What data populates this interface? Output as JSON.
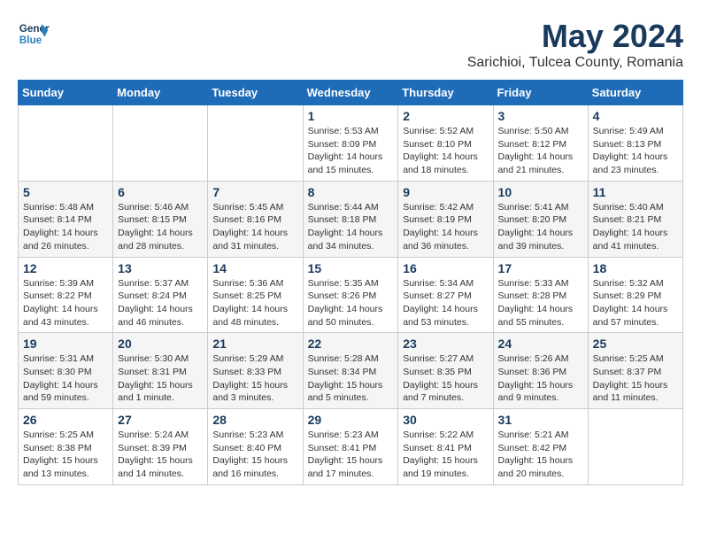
{
  "logo": {
    "line1": "General",
    "line2": "Blue"
  },
  "title": "May 2024",
  "subtitle": "Sarichioi, Tulcea County, Romania",
  "days_of_week": [
    "Sunday",
    "Monday",
    "Tuesday",
    "Wednesday",
    "Thursday",
    "Friday",
    "Saturday"
  ],
  "weeks": [
    [
      {
        "day": "",
        "sunrise": "",
        "sunset": "",
        "daylight": ""
      },
      {
        "day": "",
        "sunrise": "",
        "sunset": "",
        "daylight": ""
      },
      {
        "day": "",
        "sunrise": "",
        "sunset": "",
        "daylight": ""
      },
      {
        "day": "1",
        "sunrise": "Sunrise: 5:53 AM",
        "sunset": "Sunset: 8:09 PM",
        "daylight": "Daylight: 14 hours and 15 minutes."
      },
      {
        "day": "2",
        "sunrise": "Sunrise: 5:52 AM",
        "sunset": "Sunset: 8:10 PM",
        "daylight": "Daylight: 14 hours and 18 minutes."
      },
      {
        "day": "3",
        "sunrise": "Sunrise: 5:50 AM",
        "sunset": "Sunset: 8:12 PM",
        "daylight": "Daylight: 14 hours and 21 minutes."
      },
      {
        "day": "4",
        "sunrise": "Sunrise: 5:49 AM",
        "sunset": "Sunset: 8:13 PM",
        "daylight": "Daylight: 14 hours and 23 minutes."
      }
    ],
    [
      {
        "day": "5",
        "sunrise": "Sunrise: 5:48 AM",
        "sunset": "Sunset: 8:14 PM",
        "daylight": "Daylight: 14 hours and 26 minutes."
      },
      {
        "day": "6",
        "sunrise": "Sunrise: 5:46 AM",
        "sunset": "Sunset: 8:15 PM",
        "daylight": "Daylight: 14 hours and 28 minutes."
      },
      {
        "day": "7",
        "sunrise": "Sunrise: 5:45 AM",
        "sunset": "Sunset: 8:16 PM",
        "daylight": "Daylight: 14 hours and 31 minutes."
      },
      {
        "day": "8",
        "sunrise": "Sunrise: 5:44 AM",
        "sunset": "Sunset: 8:18 PM",
        "daylight": "Daylight: 14 hours and 34 minutes."
      },
      {
        "day": "9",
        "sunrise": "Sunrise: 5:42 AM",
        "sunset": "Sunset: 8:19 PM",
        "daylight": "Daylight: 14 hours and 36 minutes."
      },
      {
        "day": "10",
        "sunrise": "Sunrise: 5:41 AM",
        "sunset": "Sunset: 8:20 PM",
        "daylight": "Daylight: 14 hours and 39 minutes."
      },
      {
        "day": "11",
        "sunrise": "Sunrise: 5:40 AM",
        "sunset": "Sunset: 8:21 PM",
        "daylight": "Daylight: 14 hours and 41 minutes."
      }
    ],
    [
      {
        "day": "12",
        "sunrise": "Sunrise: 5:39 AM",
        "sunset": "Sunset: 8:22 PM",
        "daylight": "Daylight: 14 hours and 43 minutes."
      },
      {
        "day": "13",
        "sunrise": "Sunrise: 5:37 AM",
        "sunset": "Sunset: 8:24 PM",
        "daylight": "Daylight: 14 hours and 46 minutes."
      },
      {
        "day": "14",
        "sunrise": "Sunrise: 5:36 AM",
        "sunset": "Sunset: 8:25 PM",
        "daylight": "Daylight: 14 hours and 48 minutes."
      },
      {
        "day": "15",
        "sunrise": "Sunrise: 5:35 AM",
        "sunset": "Sunset: 8:26 PM",
        "daylight": "Daylight: 14 hours and 50 minutes."
      },
      {
        "day": "16",
        "sunrise": "Sunrise: 5:34 AM",
        "sunset": "Sunset: 8:27 PM",
        "daylight": "Daylight: 14 hours and 53 minutes."
      },
      {
        "day": "17",
        "sunrise": "Sunrise: 5:33 AM",
        "sunset": "Sunset: 8:28 PM",
        "daylight": "Daylight: 14 hours and 55 minutes."
      },
      {
        "day": "18",
        "sunrise": "Sunrise: 5:32 AM",
        "sunset": "Sunset: 8:29 PM",
        "daylight": "Daylight: 14 hours and 57 minutes."
      }
    ],
    [
      {
        "day": "19",
        "sunrise": "Sunrise: 5:31 AM",
        "sunset": "Sunset: 8:30 PM",
        "daylight": "Daylight: 14 hours and 59 minutes."
      },
      {
        "day": "20",
        "sunrise": "Sunrise: 5:30 AM",
        "sunset": "Sunset: 8:31 PM",
        "daylight": "Daylight: 15 hours and 1 minute."
      },
      {
        "day": "21",
        "sunrise": "Sunrise: 5:29 AM",
        "sunset": "Sunset: 8:33 PM",
        "daylight": "Daylight: 15 hours and 3 minutes."
      },
      {
        "day": "22",
        "sunrise": "Sunrise: 5:28 AM",
        "sunset": "Sunset: 8:34 PM",
        "daylight": "Daylight: 15 hours and 5 minutes."
      },
      {
        "day": "23",
        "sunrise": "Sunrise: 5:27 AM",
        "sunset": "Sunset: 8:35 PM",
        "daylight": "Daylight: 15 hours and 7 minutes."
      },
      {
        "day": "24",
        "sunrise": "Sunrise: 5:26 AM",
        "sunset": "Sunset: 8:36 PM",
        "daylight": "Daylight: 15 hours and 9 minutes."
      },
      {
        "day": "25",
        "sunrise": "Sunrise: 5:25 AM",
        "sunset": "Sunset: 8:37 PM",
        "daylight": "Daylight: 15 hours and 11 minutes."
      }
    ],
    [
      {
        "day": "26",
        "sunrise": "Sunrise: 5:25 AM",
        "sunset": "Sunset: 8:38 PM",
        "daylight": "Daylight: 15 hours and 13 minutes."
      },
      {
        "day": "27",
        "sunrise": "Sunrise: 5:24 AM",
        "sunset": "Sunset: 8:39 PM",
        "daylight": "Daylight: 15 hours and 14 minutes."
      },
      {
        "day": "28",
        "sunrise": "Sunrise: 5:23 AM",
        "sunset": "Sunset: 8:40 PM",
        "daylight": "Daylight: 15 hours and 16 minutes."
      },
      {
        "day": "29",
        "sunrise": "Sunrise: 5:23 AM",
        "sunset": "Sunset: 8:41 PM",
        "daylight": "Daylight: 15 hours and 17 minutes."
      },
      {
        "day": "30",
        "sunrise": "Sunrise: 5:22 AM",
        "sunset": "Sunset: 8:41 PM",
        "daylight": "Daylight: 15 hours and 19 minutes."
      },
      {
        "day": "31",
        "sunrise": "Sunrise: 5:21 AM",
        "sunset": "Sunset: 8:42 PM",
        "daylight": "Daylight: 15 hours and 20 minutes."
      },
      {
        "day": "",
        "sunrise": "",
        "sunset": "",
        "daylight": ""
      }
    ]
  ]
}
